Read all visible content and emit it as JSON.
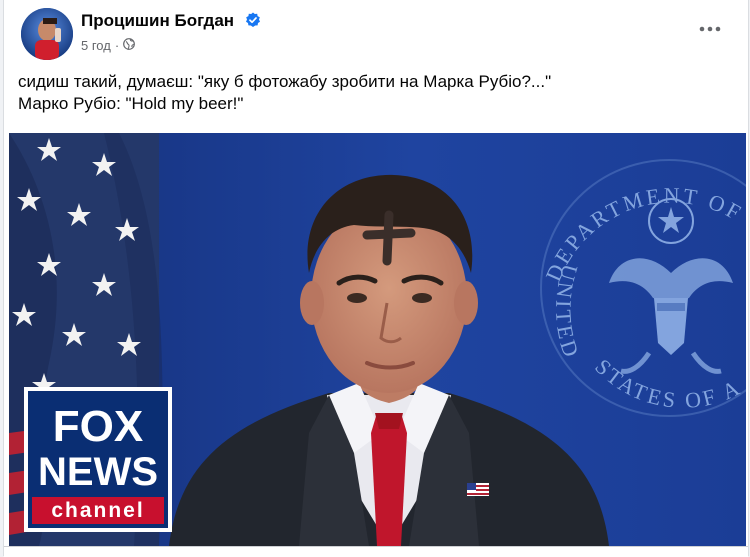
{
  "post": {
    "author": "Процишин Богдан",
    "time": "5 год",
    "separator": "·",
    "text_line1": "сидиш такий, думаєш: \"яку б фотожабу зробити на Марка Рубіо?...\"",
    "text_line2": "Марко Рубіо: \"Hold my beer!\""
  },
  "image": {
    "seal_text_top": "DEPARTMENT OF S",
    "seal_text_left": "UNITED",
    "seal_text_bottom": "STATES OF A",
    "fox_line1": "FOX",
    "fox_line2": "NEWS",
    "fox_line3": "channel"
  },
  "icons": {
    "verified": "verified-badge-icon",
    "globe": "globe-icon",
    "more": "more-options-icon"
  },
  "colors": {
    "verified_blue": "#1877f2",
    "background_blue": "#1f3f8f",
    "fox_red": "#c8102e"
  }
}
